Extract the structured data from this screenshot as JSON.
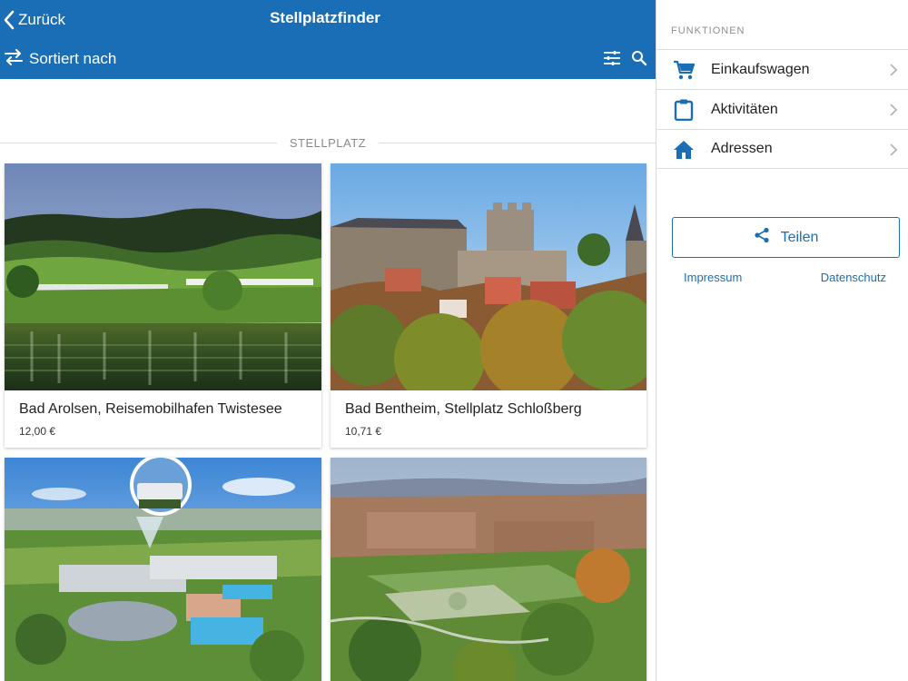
{
  "header": {
    "back_label": "Zurück",
    "title": "Stellplatzfinder",
    "sort_label": "Sortiert nach",
    "icons": [
      "filter-sliders-icon",
      "search-icon"
    ]
  },
  "section": {
    "title": "STELLPLATZ"
  },
  "cards": [
    {
      "name": "Bad Arolsen, Reisemobilhafen Twistesee",
      "price": "12,00 €",
      "image": "lake-landscape"
    },
    {
      "name": "Bad Bentheim, Stellplatz Schloßberg",
      "price": "10,71 €",
      "image": "castle-town"
    },
    {
      "name": "",
      "price": "",
      "image": "thermal-bath-aerial"
    },
    {
      "name": "",
      "price": "",
      "image": "town-aerial"
    }
  ],
  "sidebar": {
    "heading": "FUNKTIONEN",
    "items": [
      {
        "label": "Einkaufswagen",
        "icon": "cart-icon"
      },
      {
        "label": "Aktivitäten",
        "icon": "clipboard-icon"
      },
      {
        "label": "Adressen",
        "icon": "home-icon"
      }
    ],
    "share_label": "Teilen",
    "links": {
      "impressum": "Impressum",
      "datenschutz": "Datenschutz"
    }
  },
  "colors": {
    "primary": "#1a6eb5",
    "divider": "#dcdcdc"
  }
}
